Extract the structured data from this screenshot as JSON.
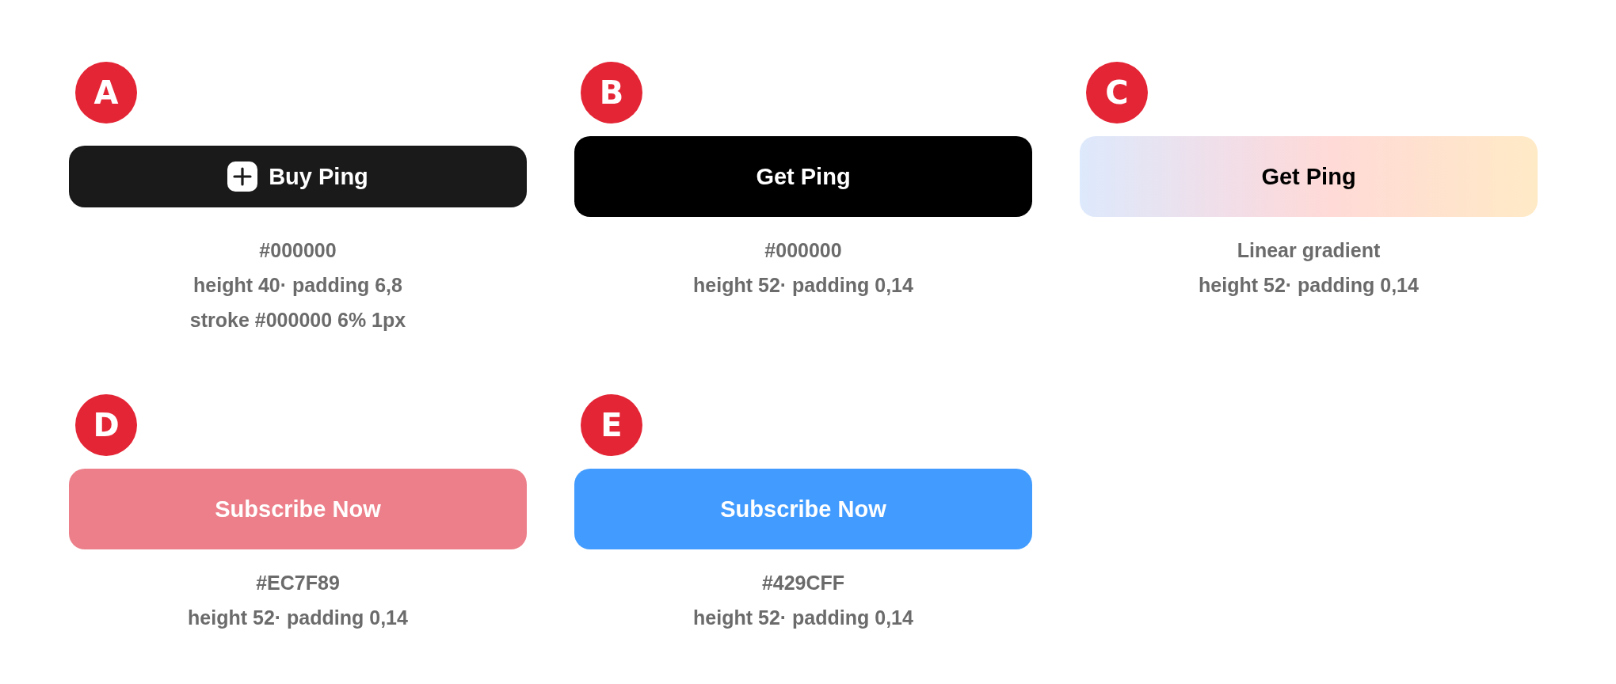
{
  "cards": [
    {
      "badge": "A",
      "button": {
        "kind": "dark",
        "label": "Buy Ping",
        "leading_icon": true
      },
      "notes": [
        "#000000",
        "height 40· padding 6,8",
        "stroke #000000 6% 1px"
      ]
    },
    {
      "badge": "B",
      "button": {
        "kind": "black",
        "label": "Get Ping"
      },
      "notes": [
        "#000000",
        "height 52· padding 0,14"
      ]
    },
    {
      "badge": "C",
      "button": {
        "kind": "gradient",
        "label": "Get Ping"
      },
      "notes": [
        "Linear gradient",
        "height 52· padding 0,14"
      ]
    },
    {
      "badge": "D",
      "button": {
        "kind": "solid",
        "color": "#ec7f89",
        "label": "Subscribe Now"
      },
      "notes": [
        "#EC7F89",
        "height 52· padding 0,14"
      ]
    },
    {
      "badge": "E",
      "button": {
        "kind": "solid",
        "color": "#429cff",
        "label": "Subscribe Now"
      },
      "notes": [
        "#429CFF",
        "height 52· padding 0,14"
      ]
    }
  ]
}
